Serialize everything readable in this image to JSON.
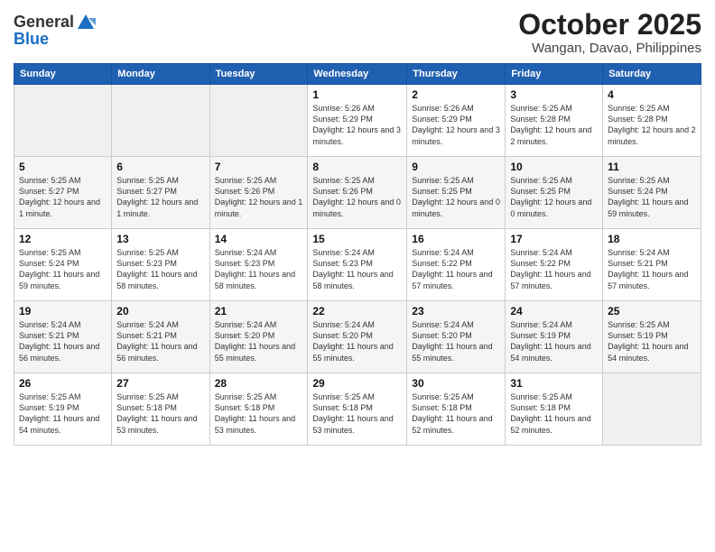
{
  "logo": {
    "general": "General",
    "blue": "Blue"
  },
  "header": {
    "month": "October 2025",
    "location": "Wangan, Davao, Philippines"
  },
  "weekdays": [
    "Sunday",
    "Monday",
    "Tuesday",
    "Wednesday",
    "Thursday",
    "Friday",
    "Saturday"
  ],
  "weeks": [
    [
      {
        "day": "",
        "info": ""
      },
      {
        "day": "",
        "info": ""
      },
      {
        "day": "",
        "info": ""
      },
      {
        "day": "1",
        "info": "Sunrise: 5:26 AM\nSunset: 5:29 PM\nDaylight: 12 hours and 3 minutes."
      },
      {
        "day": "2",
        "info": "Sunrise: 5:26 AM\nSunset: 5:29 PM\nDaylight: 12 hours and 3 minutes."
      },
      {
        "day": "3",
        "info": "Sunrise: 5:25 AM\nSunset: 5:28 PM\nDaylight: 12 hours and 2 minutes."
      },
      {
        "day": "4",
        "info": "Sunrise: 5:25 AM\nSunset: 5:28 PM\nDaylight: 12 hours and 2 minutes."
      }
    ],
    [
      {
        "day": "5",
        "info": "Sunrise: 5:25 AM\nSunset: 5:27 PM\nDaylight: 12 hours and 1 minute."
      },
      {
        "day": "6",
        "info": "Sunrise: 5:25 AM\nSunset: 5:27 PM\nDaylight: 12 hours and 1 minute."
      },
      {
        "day": "7",
        "info": "Sunrise: 5:25 AM\nSunset: 5:26 PM\nDaylight: 12 hours and 1 minute."
      },
      {
        "day": "8",
        "info": "Sunrise: 5:25 AM\nSunset: 5:26 PM\nDaylight: 12 hours and 0 minutes."
      },
      {
        "day": "9",
        "info": "Sunrise: 5:25 AM\nSunset: 5:25 PM\nDaylight: 12 hours and 0 minutes."
      },
      {
        "day": "10",
        "info": "Sunrise: 5:25 AM\nSunset: 5:25 PM\nDaylight: 12 hours and 0 minutes."
      },
      {
        "day": "11",
        "info": "Sunrise: 5:25 AM\nSunset: 5:24 PM\nDaylight: 11 hours and 59 minutes."
      }
    ],
    [
      {
        "day": "12",
        "info": "Sunrise: 5:25 AM\nSunset: 5:24 PM\nDaylight: 11 hours and 59 minutes."
      },
      {
        "day": "13",
        "info": "Sunrise: 5:25 AM\nSunset: 5:23 PM\nDaylight: 11 hours and 58 minutes."
      },
      {
        "day": "14",
        "info": "Sunrise: 5:24 AM\nSunset: 5:23 PM\nDaylight: 11 hours and 58 minutes."
      },
      {
        "day": "15",
        "info": "Sunrise: 5:24 AM\nSunset: 5:23 PM\nDaylight: 11 hours and 58 minutes."
      },
      {
        "day": "16",
        "info": "Sunrise: 5:24 AM\nSunset: 5:22 PM\nDaylight: 11 hours and 57 minutes."
      },
      {
        "day": "17",
        "info": "Sunrise: 5:24 AM\nSunset: 5:22 PM\nDaylight: 11 hours and 57 minutes."
      },
      {
        "day": "18",
        "info": "Sunrise: 5:24 AM\nSunset: 5:21 PM\nDaylight: 11 hours and 57 minutes."
      }
    ],
    [
      {
        "day": "19",
        "info": "Sunrise: 5:24 AM\nSunset: 5:21 PM\nDaylight: 11 hours and 56 minutes."
      },
      {
        "day": "20",
        "info": "Sunrise: 5:24 AM\nSunset: 5:21 PM\nDaylight: 11 hours and 56 minutes."
      },
      {
        "day": "21",
        "info": "Sunrise: 5:24 AM\nSunset: 5:20 PM\nDaylight: 11 hours and 55 minutes."
      },
      {
        "day": "22",
        "info": "Sunrise: 5:24 AM\nSunset: 5:20 PM\nDaylight: 11 hours and 55 minutes."
      },
      {
        "day": "23",
        "info": "Sunrise: 5:24 AM\nSunset: 5:20 PM\nDaylight: 11 hours and 55 minutes."
      },
      {
        "day": "24",
        "info": "Sunrise: 5:24 AM\nSunset: 5:19 PM\nDaylight: 11 hours and 54 minutes."
      },
      {
        "day": "25",
        "info": "Sunrise: 5:25 AM\nSunset: 5:19 PM\nDaylight: 11 hours and 54 minutes."
      }
    ],
    [
      {
        "day": "26",
        "info": "Sunrise: 5:25 AM\nSunset: 5:19 PM\nDaylight: 11 hours and 54 minutes."
      },
      {
        "day": "27",
        "info": "Sunrise: 5:25 AM\nSunset: 5:18 PM\nDaylight: 11 hours and 53 minutes."
      },
      {
        "day": "28",
        "info": "Sunrise: 5:25 AM\nSunset: 5:18 PM\nDaylight: 11 hours and 53 minutes."
      },
      {
        "day": "29",
        "info": "Sunrise: 5:25 AM\nSunset: 5:18 PM\nDaylight: 11 hours and 53 minutes."
      },
      {
        "day": "30",
        "info": "Sunrise: 5:25 AM\nSunset: 5:18 PM\nDaylight: 11 hours and 52 minutes."
      },
      {
        "day": "31",
        "info": "Sunrise: 5:25 AM\nSunset: 5:18 PM\nDaylight: 11 hours and 52 minutes."
      },
      {
        "day": "",
        "info": ""
      }
    ]
  ]
}
